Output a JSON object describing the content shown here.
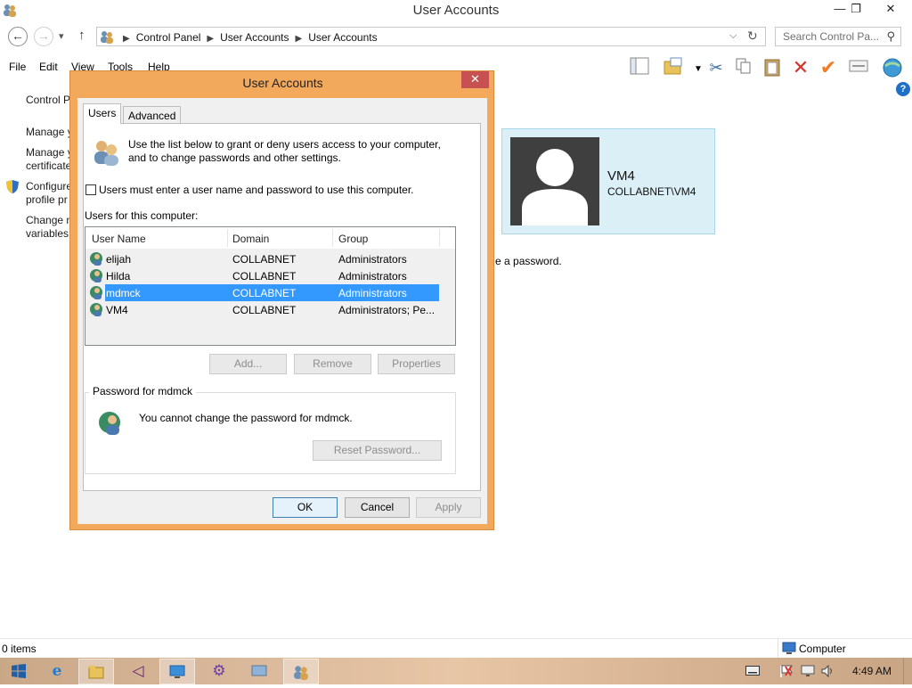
{
  "window": {
    "title": "User Accounts",
    "controls": {
      "minimize": "—",
      "restore": "❐",
      "close": "✕"
    }
  },
  "nav": {
    "back": "←",
    "forward": "→",
    "dropdown": "▾",
    "up": "↑",
    "breadcrumbs": [
      "Control Panel",
      "User Accounts",
      "User Accounts"
    ],
    "search_placeholder": "Search Control Pa...",
    "refresh": "↻"
  },
  "menu": [
    "File",
    "Edit",
    "View",
    "Tools",
    "Help"
  ],
  "left_pane": {
    "title": "Control P",
    "links": [
      {
        "text": "Manage y"
      },
      {
        "text": "Manage y",
        "line2": "certificate"
      },
      {
        "text": "Configure",
        "line2": "profile pr"
      },
      {
        "text": "Change n",
        "line2": "variables"
      }
    ]
  },
  "user_card": {
    "name": "VM4",
    "account": "COLLABNET\\VM4"
  },
  "behind_text": "e a password.",
  "status": {
    "items": "0 items",
    "location": "Computer"
  },
  "taskbar": {
    "clock": "4:49 AM"
  },
  "dialog": {
    "title": "User Accounts",
    "close": "✕",
    "tabs": [
      "Users",
      "Advanced"
    ],
    "intro": [
      "Use the list below to grant or deny users access to your computer,",
      "and to change passwords and other settings."
    ],
    "checkbox_label": "Users must enter a user name and password to use this computer.",
    "checkbox_checked": false,
    "list_label": "Users for this computer:",
    "columns": [
      "User Name",
      "Domain",
      "Group"
    ],
    "users": [
      {
        "name": "elijah",
        "domain": "COLLABNET",
        "group": "Administrators"
      },
      {
        "name": "Hilda",
        "domain": "COLLABNET",
        "group": "Administrators"
      },
      {
        "name": "mdmck",
        "domain": "COLLABNET",
        "group": "Administrators"
      },
      {
        "name": "VM4",
        "domain": "COLLABNET",
        "group": "Administrators; Pe..."
      }
    ],
    "selected_user": "mdmck",
    "buttons": {
      "add": "Add...",
      "remove": "Remove",
      "properties": "Properties"
    },
    "password_group": {
      "title": "Password for mdmck",
      "message": "You cannot change the password for mdmck.",
      "reset": "Reset Password..."
    },
    "footer": {
      "ok": "OK",
      "cancel": "Cancel",
      "apply": "Apply"
    }
  },
  "colors": {
    "dialog_frame": "#f2a95c",
    "selection": "#3399ff",
    "close_button": "#c75050",
    "card": "#dbeff7"
  }
}
